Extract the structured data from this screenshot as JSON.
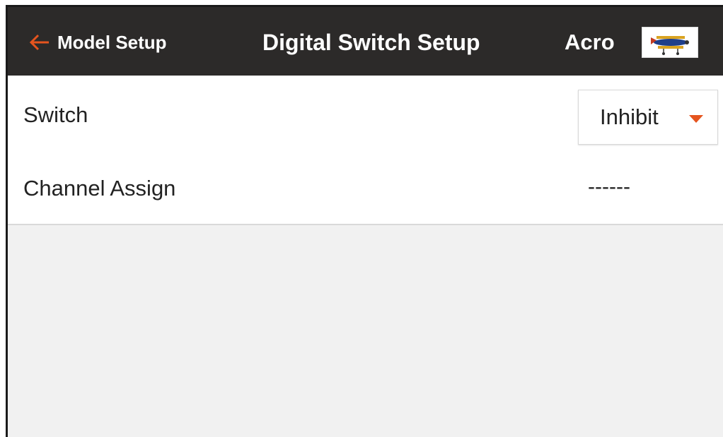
{
  "header": {
    "back_label": "Model Setup",
    "title": "Digital Switch Setup",
    "model_name": "Acro",
    "back_icon": "arrow-left-icon",
    "model_icon": "airplane-thumbnail-icon"
  },
  "colors": {
    "header_bg": "#2c2a29",
    "accent": "#e5541e",
    "background": "#f1f1f1"
  },
  "rows": [
    {
      "label": "Switch",
      "type": "dropdown",
      "value": "Inhibit",
      "icon": "caret-down-icon"
    },
    {
      "label": "Channel Assign",
      "type": "readonly",
      "value": "------"
    }
  ]
}
